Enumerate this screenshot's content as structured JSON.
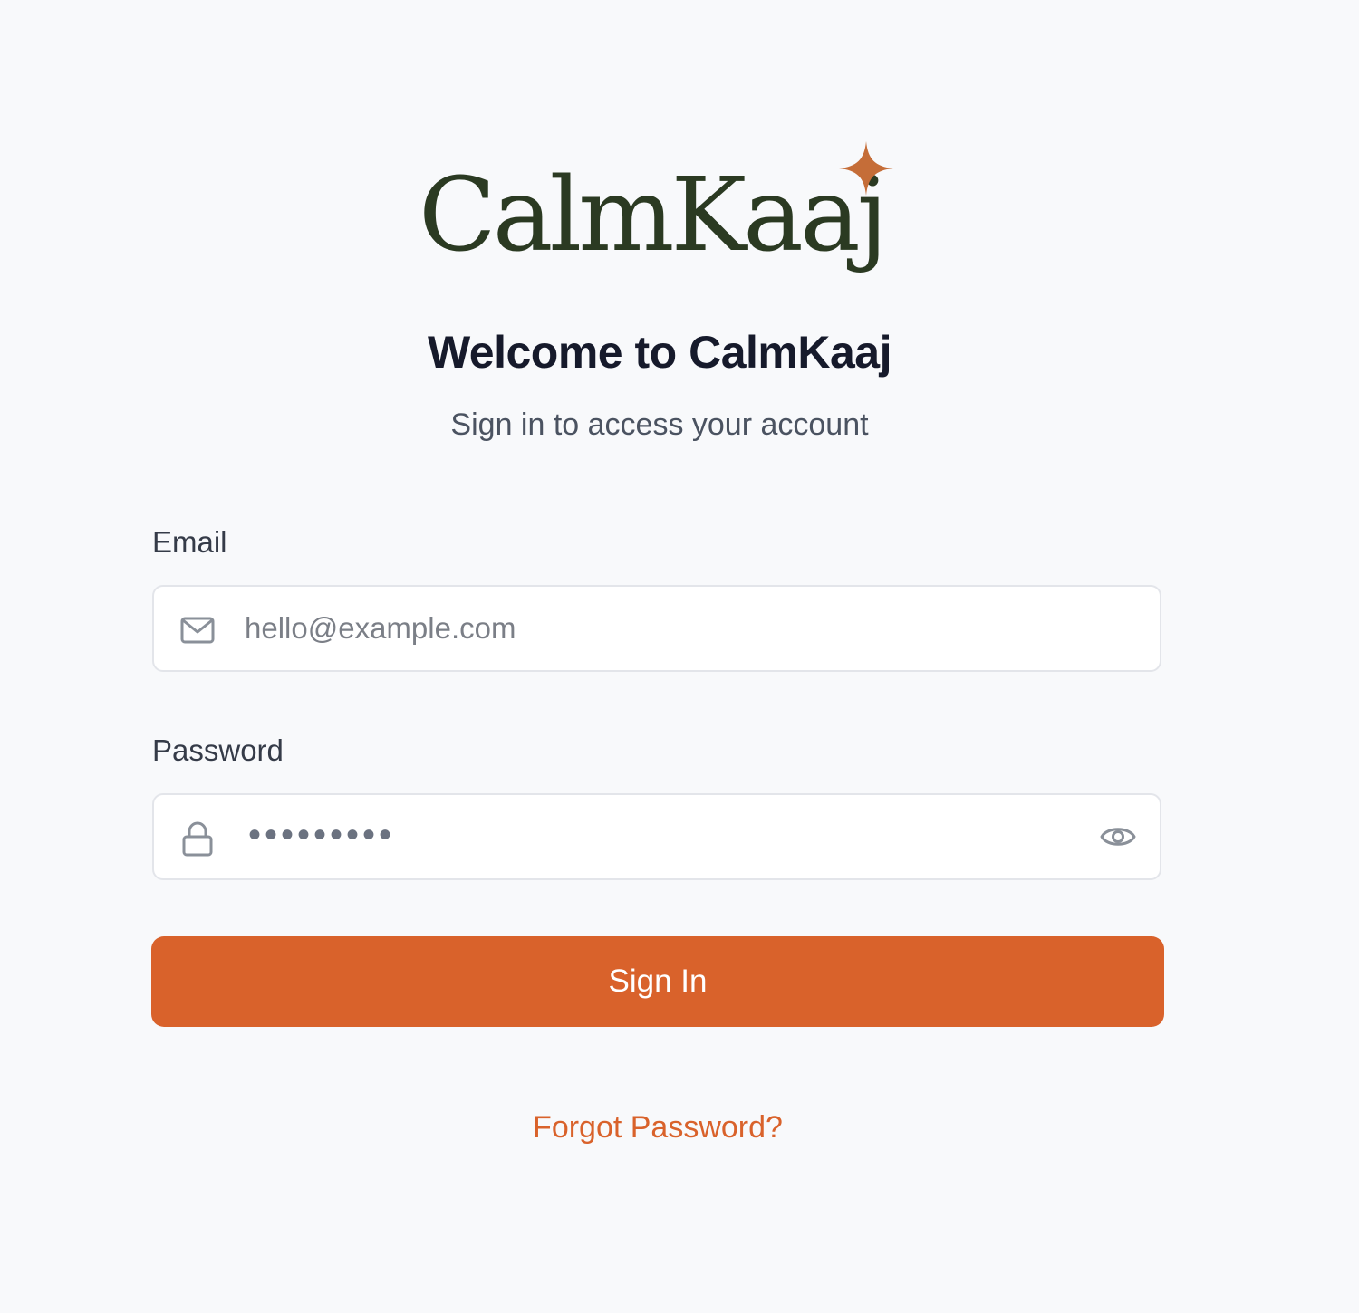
{
  "brand": {
    "logo_text": "CalmKaaj",
    "logo_color": "#2b3a22",
    "star_color": "#c56d38",
    "accent_color": "#d9622b"
  },
  "header": {
    "title": "Welcome to CalmKaaj",
    "subtitle": "Sign in to access your account"
  },
  "form": {
    "email": {
      "label": "Email",
      "placeholder": "hello@example.com",
      "value": "",
      "icon": "mail-icon"
    },
    "password": {
      "label": "Password",
      "masked_value": "•••••••••",
      "icon": "lock-icon",
      "toggle_icon": "eye-icon"
    },
    "submit_label": "Sign In",
    "forgot_label": "Forgot Password?"
  }
}
